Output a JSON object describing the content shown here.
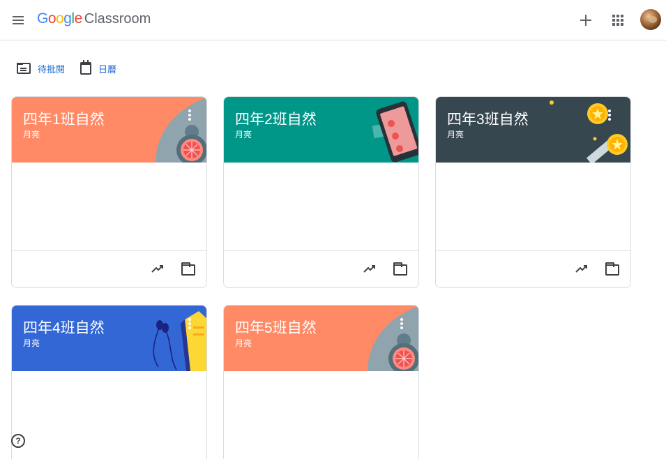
{
  "header": {
    "logo": [
      "G",
      "o",
      "o",
      "g",
      "l",
      "e"
    ],
    "product": "Classroom",
    "menu_icon": "hamburger-menu-icon",
    "create_icon": "plus-icon",
    "apps_icon": "apps-grid-icon"
  },
  "subnav": {
    "todo_label": "待批閱",
    "calendar_label": "日曆"
  },
  "classes": [
    {
      "title": "四年1班自然",
      "teacher": "月亮",
      "color": "#ff8a65",
      "theme": "science-orange"
    },
    {
      "title": "四年2班自然",
      "teacher": "月亮",
      "color": "#009688",
      "theme": "phone-teal"
    },
    {
      "title": "四年3班自然",
      "teacher": "月亮",
      "color": "#37474f",
      "theme": "space-dark"
    },
    {
      "title": "四年4班自然",
      "teacher": "月亮",
      "color": "#3367d6",
      "theme": "music-blue"
    },
    {
      "title": "四年5班自然",
      "teacher": "月亮",
      "color": "#ff8a65",
      "theme": "science-orange"
    }
  ],
  "help": {
    "label": "?"
  }
}
